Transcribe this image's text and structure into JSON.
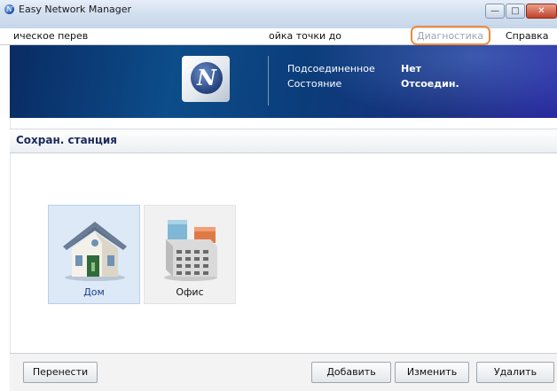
{
  "window": {
    "title": "Easy Network Manager",
    "icon": "app-logo-icon",
    "controls": [
      "minimize-icon",
      "maximize-icon",
      "close-icon"
    ],
    "min_glyph": "—",
    "max_glyph": "□",
    "close_glyph": "✕"
  },
  "menu": {
    "items": [
      "ическое перев",
      "ойка точки до",
      "Диагностика",
      "Справка"
    ],
    "highlighted_index": 2,
    "highlight_color": "#f08c3a"
  },
  "banner": {
    "logo_letter": "N",
    "connected_label": "Подсоединенное",
    "connected_value": "Нет",
    "status_label": "Состояние",
    "status_value": "Отсоедин."
  },
  "section": {
    "title": "Сохран. станция"
  },
  "stations": [
    {
      "label": "Дом",
      "icon": "house-icon",
      "selected": true
    },
    {
      "label": "Офис",
      "icon": "office-building-icon",
      "selected": false
    }
  ],
  "buttons": {
    "move": "Перенести",
    "add": "Добавить",
    "edit": "Изменить",
    "delete": "Удалить"
  },
  "colors": {
    "banner_dark": "#0a2b63",
    "selected_tile": "#dde9f6",
    "section_title": "#1a2a5a"
  }
}
